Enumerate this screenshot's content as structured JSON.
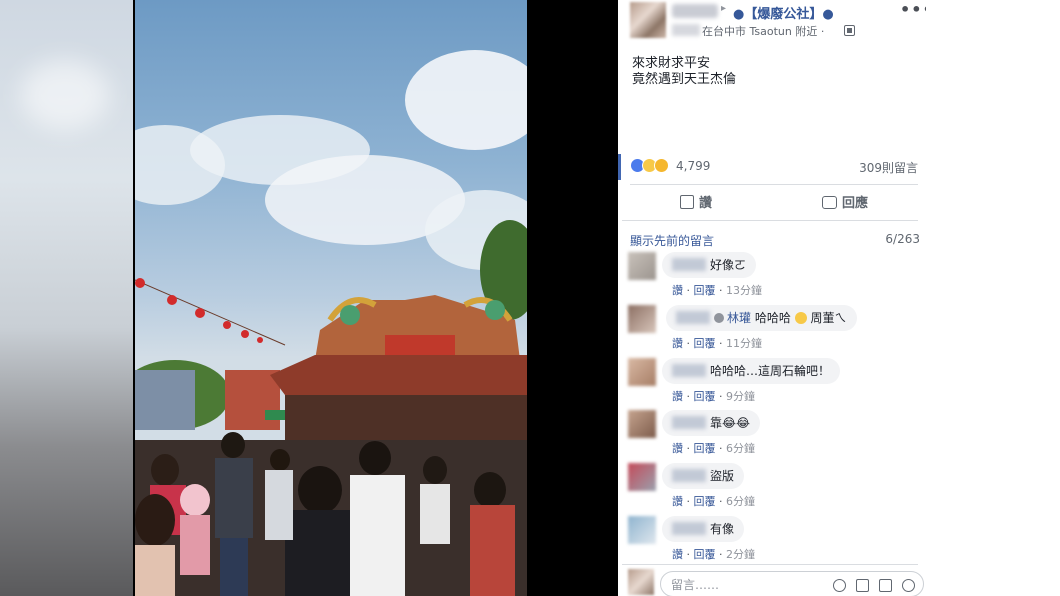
{
  "post": {
    "arrow": "▸",
    "page_name": "●【爆廢公社】●",
    "location": "在台中市 Tsaotun 附近 ·",
    "more": "•••",
    "caption_line1": "來求財求平安",
    "caption_line2": "竟然遇到天王杰倫"
  },
  "reactions": {
    "count": "4,799",
    "comments": "309則留言",
    "icons": [
      "like-icon",
      "haha-icon",
      "wow-icon"
    ]
  },
  "actions": {
    "like": "讚",
    "comment": "回應"
  },
  "comments_section": {
    "prev_link": "顯示先前的留言",
    "page_count": "6/263",
    "items": [
      {
        "text": "好像ㄛ",
        "like": "讚",
        "reply": "回覆",
        "time": "13分鐘"
      },
      {
        "tag": "林瓘",
        "text": "哈哈哈",
        "suffix": "周董ㄟ",
        "like": "讚",
        "reply": "回覆",
        "time": "11分鐘"
      },
      {
        "text": "哈哈哈…這周石輪吧！",
        "like": "讚",
        "reply": "回覆",
        "time": "9分鐘"
      },
      {
        "text": "靠😂😂",
        "like": "讚",
        "reply": "回覆",
        "time": "6分鐘"
      },
      {
        "text": "盜版",
        "like": "讚",
        "reply": "回覆",
        "time": "6分鐘"
      },
      {
        "text": "有像",
        "like": "讚",
        "reply": "回覆",
        "time": "2分鐘"
      }
    ]
  },
  "composer": {
    "placeholder": "留言……"
  }
}
